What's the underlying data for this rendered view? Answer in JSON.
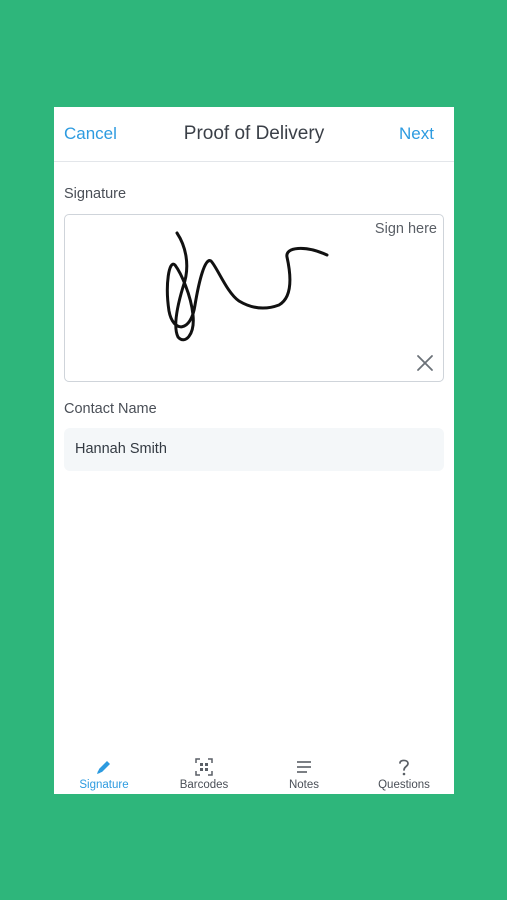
{
  "header": {
    "cancel_label": "Cancel",
    "title": "Proof of Delivery",
    "next_label": "Next"
  },
  "signature": {
    "section_label": "Signature",
    "hint": "Sign here"
  },
  "contact": {
    "section_label": "Contact Name",
    "value": "Hannah Smith"
  },
  "tabs": [
    {
      "label": "Signature",
      "icon": "pencil-icon",
      "active": true
    },
    {
      "label": "Barcodes",
      "icon": "barcode-scan-icon",
      "active": false
    },
    {
      "label": "Notes",
      "icon": "notes-lines-icon",
      "active": false
    },
    {
      "label": "Questions",
      "icon": "question-mark-icon",
      "active": false
    }
  ],
  "colors": {
    "background": "#2eb67b",
    "accent": "#2d9be0",
    "field_bg": "#f4f7f9"
  }
}
